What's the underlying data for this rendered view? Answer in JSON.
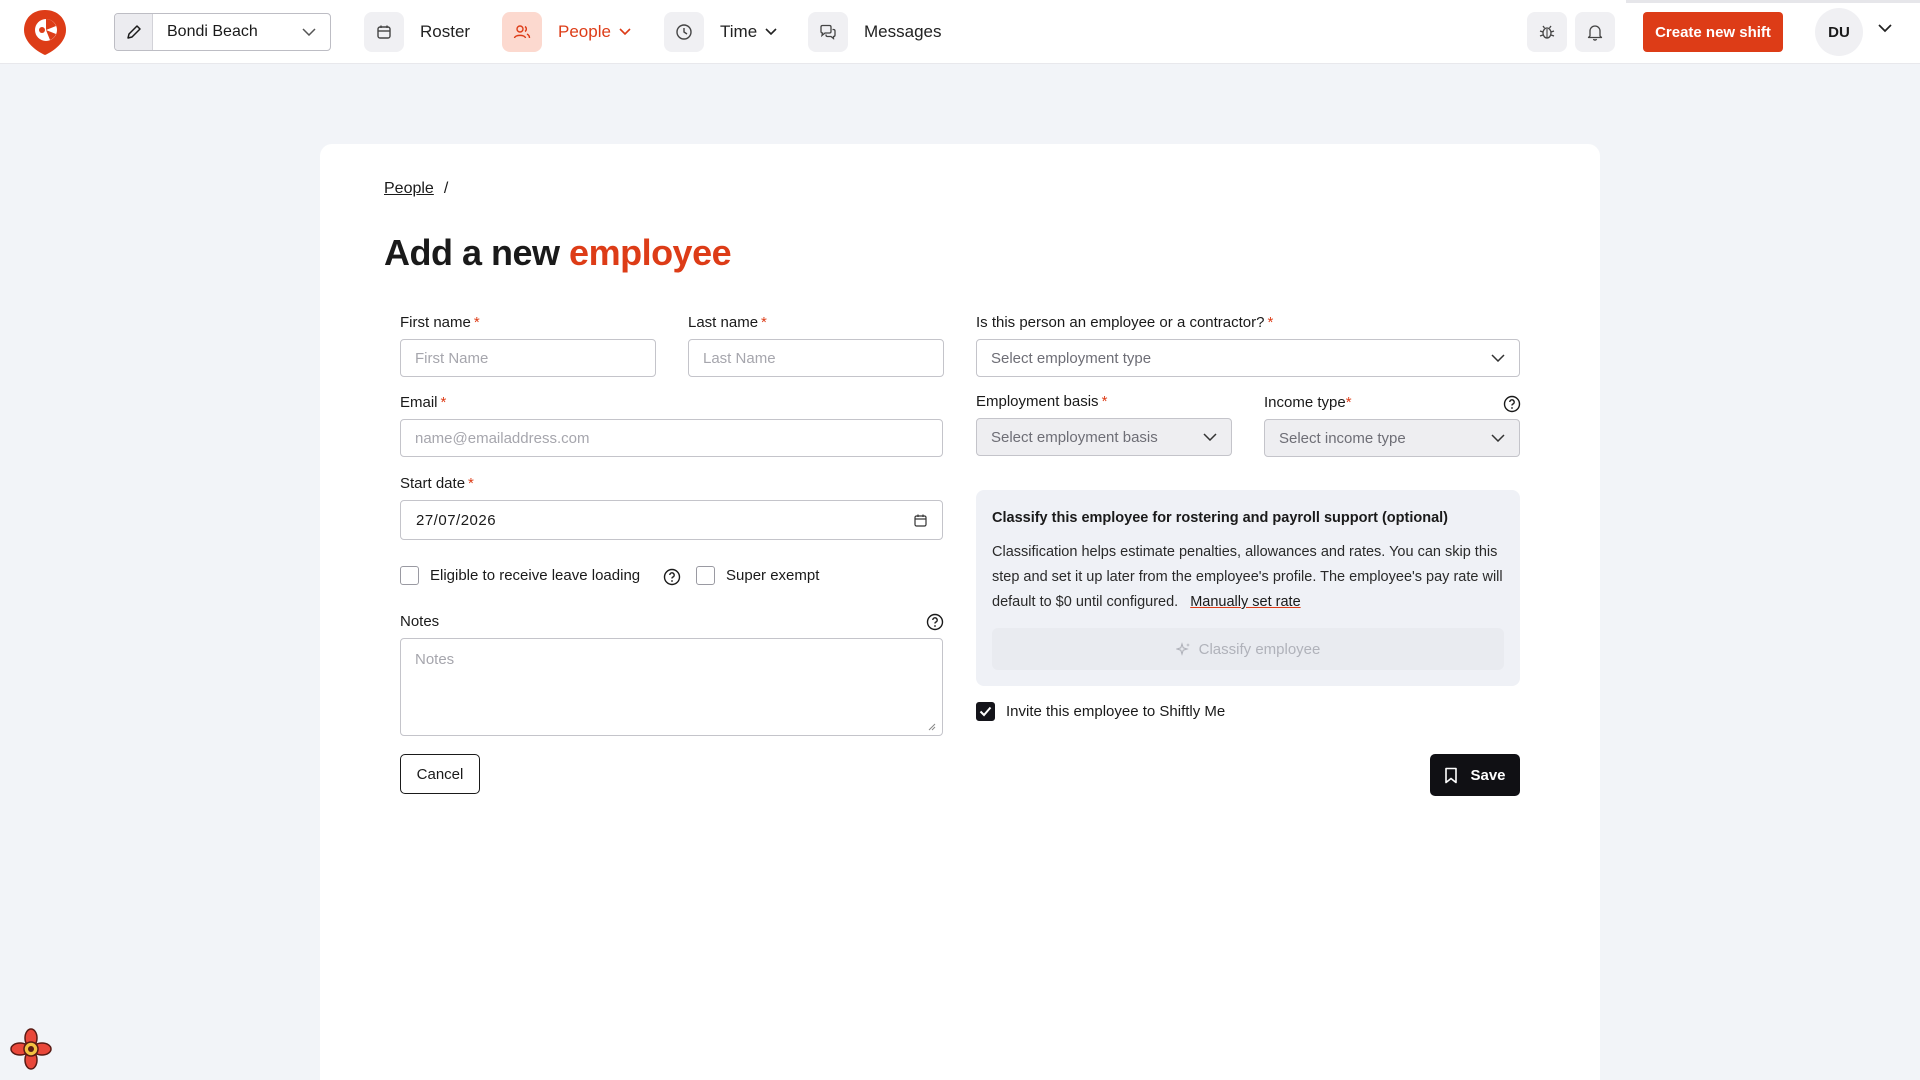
{
  "header": {
    "location": "Bondi Beach",
    "nav": [
      {
        "label": "Roster",
        "icon": "calendar-icon",
        "active": false,
        "has_dropdown": false
      },
      {
        "label": "People",
        "icon": "people-icon",
        "active": true,
        "has_dropdown": true
      },
      {
        "label": "Time",
        "icon": "clock-icon",
        "active": false,
        "has_dropdown": true
      },
      {
        "label": "Messages",
        "icon": "chat-icon",
        "active": false,
        "has_dropdown": false
      }
    ],
    "create_button": "Create new shift",
    "avatar_initials": "DU"
  },
  "colors": {
    "accent": "#dd3c17",
    "dark": "#101014",
    "background": "#f2f4f8"
  },
  "breadcrumb": {
    "parent": "People",
    "separator": "/"
  },
  "title": {
    "prefix": "Add a new",
    "highlight": "employee"
  },
  "form": {
    "first_name": {
      "label": "First name",
      "placeholder": "First Name"
    },
    "last_name": {
      "label": "Last name",
      "placeholder": "Last Name"
    },
    "employment_type": {
      "label": "Is this person an employee or a contractor?",
      "placeholder": "Select employment type"
    },
    "email": {
      "label": "Email",
      "placeholder": "name@emailaddress.com"
    },
    "employment_basis": {
      "label": "Employment basis",
      "placeholder": "Select employment basis"
    },
    "income_type": {
      "label": "Income type",
      "placeholder": "Select income type"
    },
    "start_date": {
      "label": "Start date",
      "value": "27/07/2026"
    },
    "leave_loading": {
      "label": "Eligible to receive leave loading",
      "checked": false
    },
    "super_exempt": {
      "label": "Super exempt",
      "checked": false
    },
    "notes": {
      "label": "Notes",
      "placeholder": "Notes"
    },
    "required_mark": "*"
  },
  "classify": {
    "title": "Classify this employee for rostering and payroll support (optional)",
    "description": "Classification helps estimate penalties, allowances and rates. You can skip this step and set it up later from the employee's profile. The employee's pay rate will default to $0 until configured.",
    "link": "Manually set rate",
    "button": "Classify employee"
  },
  "invite": {
    "label": "Invite this employee to Shiftly Me",
    "checked": true
  },
  "actions": {
    "cancel": "Cancel",
    "save": "Save"
  }
}
